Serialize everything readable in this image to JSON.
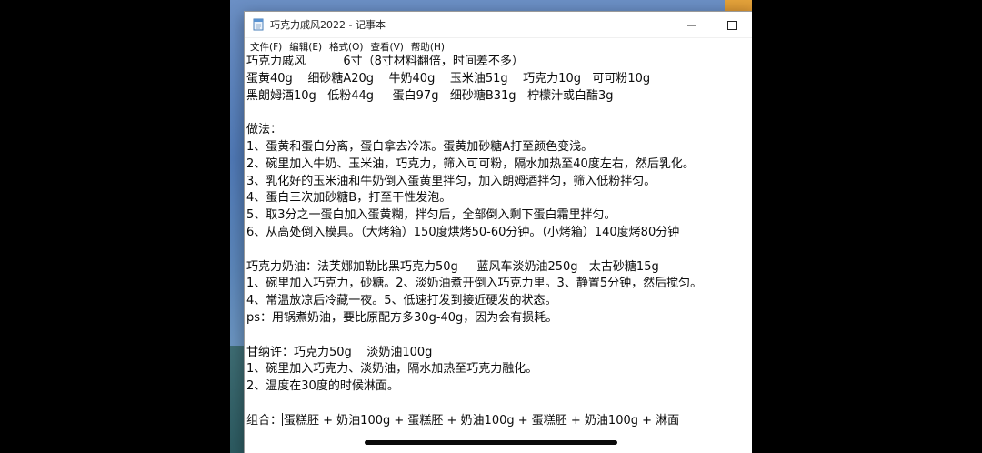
{
  "window": {
    "title": "巧克力戚风2022 - 记事本",
    "icon": "notepad-icon",
    "controls": [
      "minimize-icon",
      "maximize-icon"
    ]
  },
  "menu": [
    {
      "label": "文件(F)"
    },
    {
      "label": "编辑(E)"
    },
    {
      "label": "格式(O)"
    },
    {
      "label": "查看(V)"
    },
    {
      "label": "帮助(H)"
    }
  ],
  "document": {
    "lines": [
      "巧克力戚风          6寸（8寸材料翻倍，时间差不多）",
      "蛋黄40g    细砂糖A20g    牛奶40g    玉米油51g    巧克力10g   可可粉10g",
      "黑朗姆酒10g   低粉44g     蛋白97g   细砂糖B31g   柠檬汁或白醋3g",
      "",
      "做法：",
      "1、蛋黄和蛋白分离，蛋白拿去冷冻。蛋黄加砂糖A打至颜色变浅。",
      "2、碗里加入牛奶、玉米油，巧克力，筛入可可粉，隔水加热至40度左右，然后乳化。",
      "3、乳化好的玉米油和牛奶倒入蛋黄里拌匀，加入朗姆酒拌匀，筛入低粉拌匀。",
      "4、蛋白三次加砂糖B，打至干性发泡。",
      "5、取3分之一蛋白加入蛋黄糊，拌匀后，全部倒入剩下蛋白霜里拌匀。",
      "6、从高处倒入模具。（大烤箱）150度烘烤50-60分钟。（小烤箱）140度烤80分钟",
      "",
      "巧克力奶油：法芙娜加勒比黑巧克力50g     蓝风车淡奶油250g   太古砂糖15g",
      "1、碗里加入巧克力，砂糖。2、淡奶油煮开倒入巧克力里。3、静置5分钟，然后搅匀。",
      "4、常温放凉后冷藏一夜。5、低速打发到接近硬发的状态。",
      "ps：用锅煮奶油，要比原配方多30g-40g，因为会有损耗。",
      "",
      "甘纳许：巧克力50g    淡奶油100g",
      "1、碗里加入巧克力、淡奶油，隔水加热至巧克力融化。",
      "2、温度在30度的时候淋面。",
      "",
      "组合：",
      "蛋糕胚 + 奶油100g + 蛋糕胚 + 奶油100g + 蛋糕胚 + 奶油100g + 淋面"
    ]
  }
}
